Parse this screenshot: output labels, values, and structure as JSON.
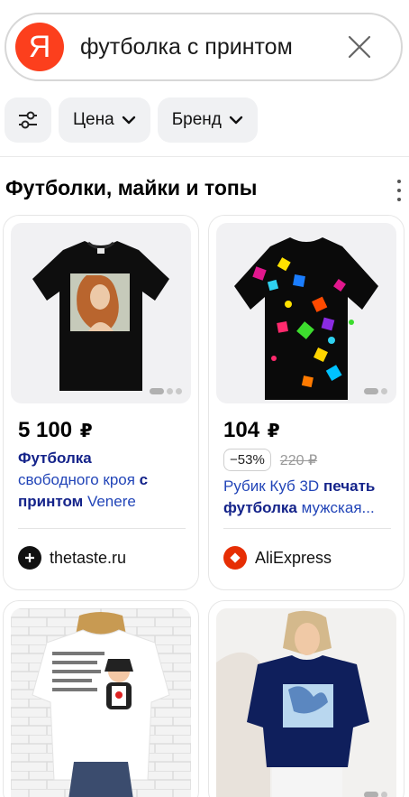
{
  "search": {
    "logo_letter": "Я",
    "query": "футболка с принтом"
  },
  "filters": {
    "price_label": "Цена",
    "brand_label": "Бренд"
  },
  "section": {
    "title": "Футболки, майки и топы"
  },
  "products": [
    {
      "price": "5 100",
      "currency": "₽",
      "title_parts": [
        "Футболка",
        "свободного кроя",
        "с принтом",
        "Venere"
      ],
      "seller": "thetaste.ru"
    },
    {
      "price": "104",
      "currency": "₽",
      "discount": "−53%",
      "old_price": "220 ₽",
      "title_parts": [
        "Рубик Куб 3D",
        "печать футболка",
        "мужская..."
      ],
      "seller": "AliExpress"
    },
    {
      "print_text": "Гастроли, не хотя самого а сингей неудобов, нерамо, я теперь не делать"
    },
    {}
  ],
  "colors": {
    "yandex_red": "#fc3f1d",
    "title_blue": "#14238a",
    "aliexpress_red": "#e62e04"
  }
}
